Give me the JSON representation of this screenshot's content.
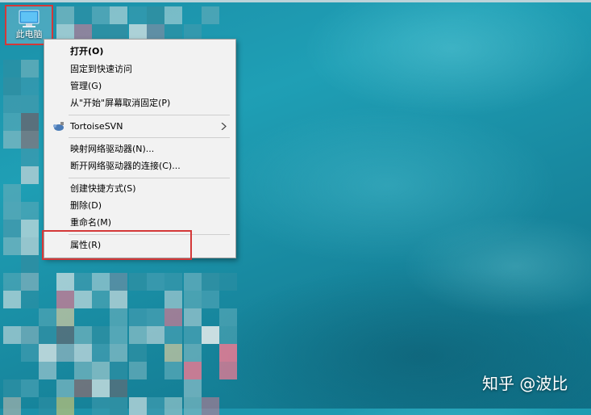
{
  "desktop": {
    "icon_label": "此电脑"
  },
  "context_menu": {
    "items": [
      {
        "label": "打开(O)"
      },
      {
        "label": "固定到快速访问"
      },
      {
        "label": "管理(G)"
      },
      {
        "label": "从\"开始\"屏幕取消固定(P)"
      },
      {
        "label": "TortoiseSVN"
      },
      {
        "label": "映射网络驱动器(N)..."
      },
      {
        "label": "断开网络驱动器的连接(C)..."
      },
      {
        "label": "创建快捷方式(S)"
      },
      {
        "label": "删除(D)"
      },
      {
        "label": "重命名(M)"
      },
      {
        "label": "属性(R)"
      }
    ]
  },
  "watermark": "知乎 @波比",
  "colors": {
    "highlight_border": "#d43838",
    "menu_background": "#f2f2f2"
  }
}
